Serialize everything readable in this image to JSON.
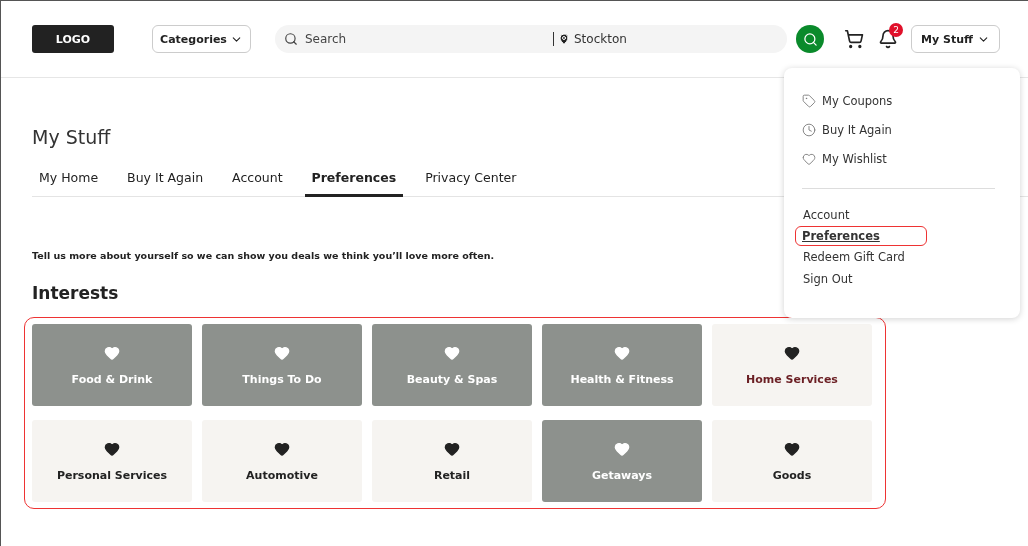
{
  "header": {
    "logo": "LOGO",
    "categories_button": "Categories",
    "search": {
      "placeholder": "Search",
      "location": "Stockton"
    },
    "notification_count": "2",
    "account_button": "My Stuff"
  },
  "page": {
    "title": "My Stuff",
    "tabs": [
      {
        "label": "My Home",
        "selected": false
      },
      {
        "label": "Buy It Again",
        "selected": false
      },
      {
        "label": "Account",
        "selected": false
      },
      {
        "label": "Preferences",
        "selected": true
      },
      {
        "label": "Privacy Center",
        "selected": false
      }
    ],
    "intro": "Tell us more about yourself so we can show you deals we think you’ll love more often.",
    "interests": {
      "title": "Interests",
      "highlighted": true,
      "items": [
        {
          "label": "Food & Drink",
          "selected": true,
          "hovered": false
        },
        {
          "label": "Things To Do",
          "selected": true,
          "hovered": false
        },
        {
          "label": "Beauty & Spas",
          "selected": true,
          "hovered": false
        },
        {
          "label": "Health & Fitness",
          "selected": true,
          "hovered": false
        },
        {
          "label": "Home Services",
          "selected": false,
          "hovered": true
        },
        {
          "label": "Personal Services",
          "selected": false,
          "hovered": false
        },
        {
          "label": "Automotive",
          "selected": false,
          "hovered": false
        },
        {
          "label": "Retail",
          "selected": false,
          "hovered": false
        },
        {
          "label": "Getaways",
          "selected": true,
          "hovered": false
        },
        {
          "label": "Goods",
          "selected": false,
          "hovered": false
        }
      ]
    }
  },
  "account_menu": {
    "icon_items": [
      {
        "label": "My Coupons",
        "kind": "tag"
      },
      {
        "label": "Buy It Again",
        "kind": "clock"
      },
      {
        "label": "My Wishlist",
        "kind": "heart"
      }
    ],
    "items": [
      {
        "label": "Account",
        "selected": false,
        "highlighted": false
      },
      {
        "label": "Preferences",
        "selected": true,
        "highlighted": true
      },
      {
        "label": "Redeem Gift Card",
        "selected": false,
        "highlighted": false
      },
      {
        "label": "Sign Out",
        "selected": false,
        "highlighted": false
      }
    ]
  }
}
